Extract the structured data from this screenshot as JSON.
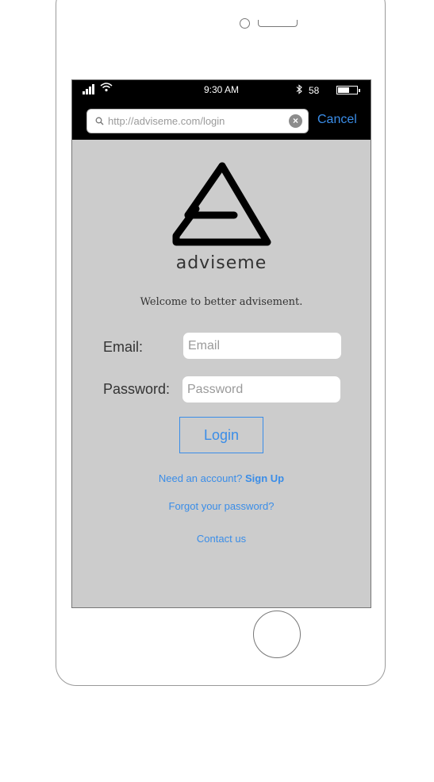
{
  "browser": {
    "url_placeholder": "http://adviseme.com/login",
    "cancel_label": "Cancel"
  },
  "status_bar": {
    "time": "9:30 AM",
    "battery_percent": "58",
    "battery_level": 0.6
  },
  "app": {
    "brand_name": "adviseme",
    "welcome_text": "Welcome to better advisement."
  },
  "form": {
    "email_label": "Email:",
    "email_placeholder": "Email",
    "password_label": "Password:",
    "password_placeholder": "Password",
    "login_label": "Login"
  },
  "links": {
    "signup_prompt": "Need an account?",
    "signup_label": "Sign Up",
    "forgot_password": "Forgot your password?",
    "contact_us": "Contact us"
  },
  "colors": {
    "link": "#3a8de8",
    "screen_background": "#cccccc",
    "browser_bar": "#000000"
  },
  "icons": [
    "signal-icon",
    "wifi-icon",
    "bluetooth-icon",
    "battery-icon",
    "search-icon",
    "clear-icon",
    "logo-triangle-icon"
  ]
}
